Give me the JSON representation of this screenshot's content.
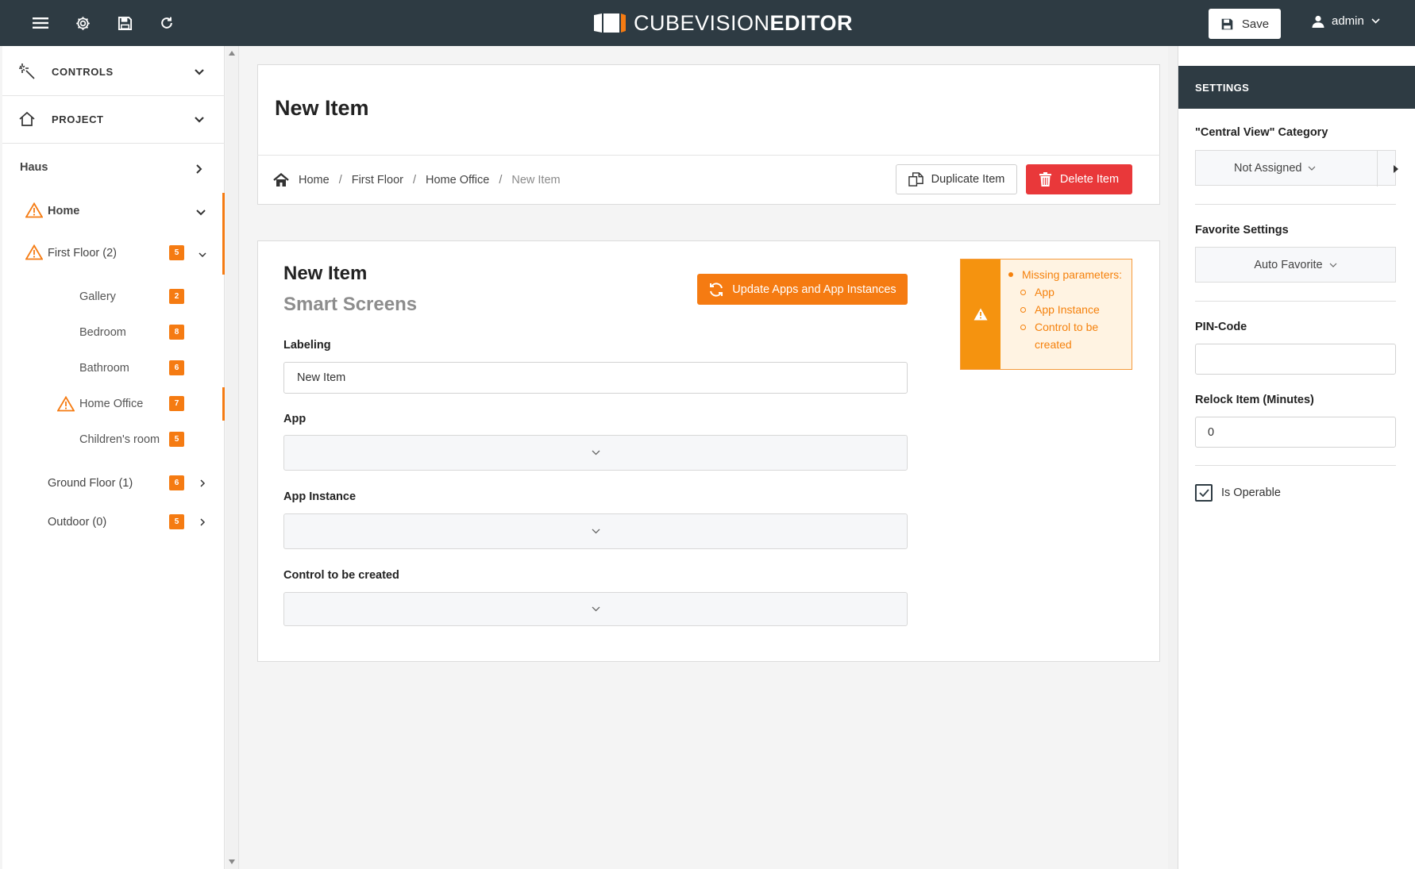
{
  "app": {
    "title_part1": "CUBEVISION",
    "title_part2": "EDITOR",
    "save_label": "Save",
    "user_name": "admin"
  },
  "sidebar": {
    "sections": [
      {
        "label": "CONTROLS",
        "icon": "magic-wand-icon"
      },
      {
        "label": "PROJECT",
        "icon": "home-outline-icon"
      }
    ],
    "root": "Haus",
    "tree": [
      {
        "label": "Home",
        "warning": true
      },
      {
        "label": "First Floor (2)",
        "warning": true,
        "badge": "5"
      },
      {
        "label": "Gallery",
        "badge": "2"
      },
      {
        "label": "Bedroom",
        "badge": "8"
      },
      {
        "label": "Bathroom",
        "badge": "6"
      },
      {
        "label": "Home Office",
        "warning": true,
        "badge": "7",
        "active": true
      },
      {
        "label": "Children's room",
        "badge": "5"
      },
      {
        "label": "Ground Floor (1)",
        "badge": "6"
      },
      {
        "label": "Outdoor (0)",
        "badge": "5"
      }
    ]
  },
  "page": {
    "title": "New Item",
    "breadcrumb": [
      "Home",
      "First Floor",
      "Home Office",
      "New Item"
    ],
    "duplicate_label": "Duplicate Item",
    "delete_label": "Delete Item"
  },
  "item": {
    "title": "New Item",
    "subtitle": "Smart Screens",
    "update_label": "Update Apps and App Instances",
    "warning": {
      "heading": "Missing parameters:",
      "items": [
        "App",
        "App Instance",
        "Control to be",
        "created"
      ]
    },
    "fields": {
      "labeling_label": "Labeling",
      "labeling_value": "New Item",
      "app_label": "App",
      "app_instance_label": "App Instance",
      "control_label": "Control to be created"
    }
  },
  "settings": {
    "heading": "SETTINGS",
    "category_label": "\"Central View\" Category",
    "category_value": "Not Assigned",
    "favorite_label": "Favorite Settings",
    "favorite_value": "Auto Favorite",
    "pin_label": "PIN-Code",
    "pin_value": "",
    "relock_label": "Relock Item (Minutes)",
    "relock_value": "0",
    "operable_label": "Is Operable",
    "operable_checked": true
  },
  "colors": {
    "topbar": "#2e3b43",
    "accent": "#f57b12",
    "danger": "#e9383a"
  }
}
